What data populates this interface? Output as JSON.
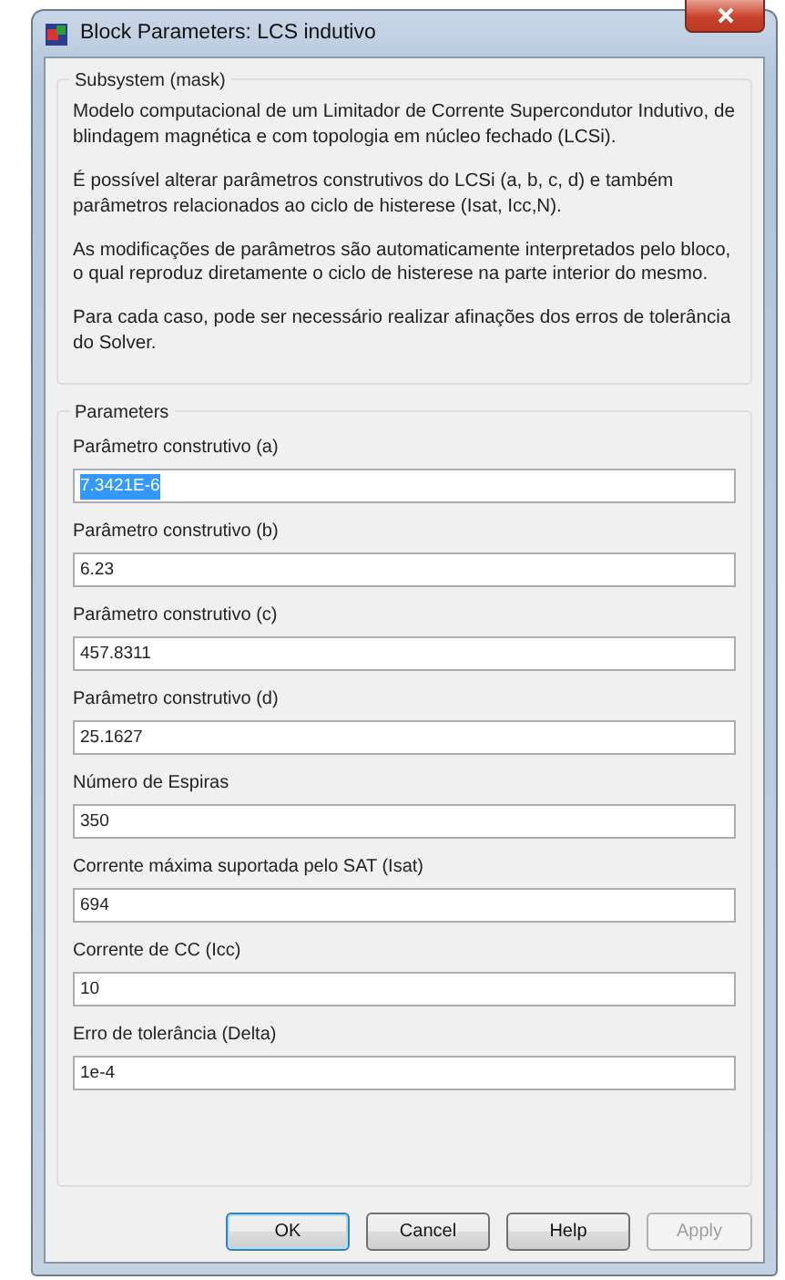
{
  "window": {
    "title": "Block Parameters: LCS indutivo"
  },
  "description": {
    "legend": "Subsystem (mask)",
    "paragraphs": [
      "Modelo computacional de um Limitador de Corrente Supercondutor Indutivo, de blindagem magnética e com topologia em núcleo fechado (LCSi).",
      "É possível alterar parâmetros construtivos do LCSi (a, b, c, d) e também parâmetros relacionados ao ciclo de histerese (Isat, Icc,N).",
      "As modificações de parâmetros são automaticamente interpretados pelo bloco, o qual reproduz diretamente o ciclo de histerese na parte interior do mesmo.",
      "Para cada caso, pode ser necessário realizar afinações dos erros de tolerância do Solver."
    ]
  },
  "parameters": {
    "legend": "Parameters",
    "fields": [
      {
        "label": "Parâmetro construtivo (a)",
        "value": "7.3421E-6",
        "selected": true
      },
      {
        "label": "Parâmetro construtivo (b)",
        "value": "6.23",
        "selected": false
      },
      {
        "label": "Parâmetro construtivo (c)",
        "value": "457.8311",
        "selected": false
      },
      {
        "label": "Parâmetro construtivo (d)",
        "value": "25.1627",
        "selected": false
      },
      {
        "label": "Número de Espiras",
        "value": "350",
        "selected": false
      },
      {
        "label": "Corrente máxima suportada pelo SAT (Isat)",
        "value": "694",
        "selected": false
      },
      {
        "label": "Corrente de CC (Icc)",
        "value": "10",
        "selected": false
      },
      {
        "label": "Erro de tolerância (Delta)",
        "value": "1e-4",
        "selected": false
      }
    ]
  },
  "buttons": [
    {
      "label": "OK",
      "default": true,
      "disabled": false
    },
    {
      "label": "Cancel",
      "default": false,
      "disabled": false
    },
    {
      "label": "Help",
      "default": false,
      "disabled": false
    },
    {
      "label": "Apply",
      "default": false,
      "disabled": true
    }
  ]
}
